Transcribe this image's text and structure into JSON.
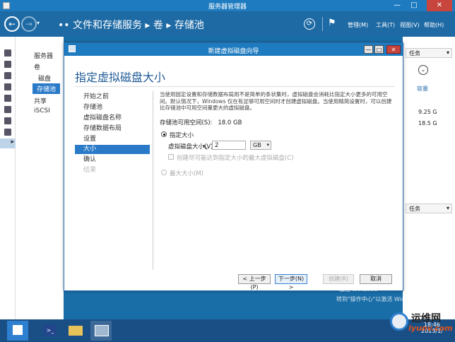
{
  "window": {
    "title": "服务器管理器",
    "min": "—",
    "max": "□",
    "close": "✕"
  },
  "addressbar": {
    "back": "←",
    "forward": "→",
    "dropdown": "▾",
    "breadcrumb": "•• 文件和存储服务 ▸ 卷 ▸ 存储池",
    "refresh": "⟳",
    "flag": "⚑",
    "menus": [
      "管理(M)",
      "工具(T)",
      "视图(V)",
      "帮助(H)"
    ]
  },
  "nav": {
    "items": [
      "服务器",
      "卷",
      "磁盘",
      "存储池",
      "共享",
      "iSCSI"
    ],
    "selected": "存储池"
  },
  "background_right": {
    "tasks_label": "任务",
    "capacity_label": "容量",
    "val1": "9.25 G",
    "val2": "18.5 G",
    "tasks_label2": "任务"
  },
  "dialog": {
    "title": "新建虚拟磁盘向导",
    "heading": "指定虚拟磁盘大小",
    "steps": [
      "开始之前",
      "存储池",
      "虚拟磁盘名称",
      "存储数据布局",
      "设置",
      "大小",
      "确认",
      "结果"
    ],
    "current_step": "大小",
    "description": "当使用固定设置和存储数据布局用不是简单的条状集时，虚拟磁盘会消耗比指定大小更多的可用空间。默认情况下，Windows 仅在有足够可用空间时才创建虚拟磁盘。当使用精简设置时，可以创建比存储池中可用空间量更大的虚拟磁盘。",
    "available_label": "存储池可用空间(S):",
    "available_value": "18.0 GB",
    "option_specify": "指定大小",
    "size_label": "虚拟磁盘大小(V):",
    "size_value": "2",
    "unit": "GB",
    "checkbox_label": "创建尽可能达到指定大小的最大虚拟磁盘(C)",
    "option_max": "最大大小(M)",
    "buttons": {
      "prev": "< 上一步(P)",
      "next": "下一步(N) >",
      "create": "创建(R)",
      "cancel": "取消"
    }
  },
  "taskbar": {
    "time": "18:46",
    "date": "2013/1/"
  },
  "watermark": {
    "activate1": "激活 Windows",
    "activate2": "转到\"操作中心\"以激活 Windows。",
    "logo_text": "运维网",
    "logo_url": "iyunv.com"
  }
}
